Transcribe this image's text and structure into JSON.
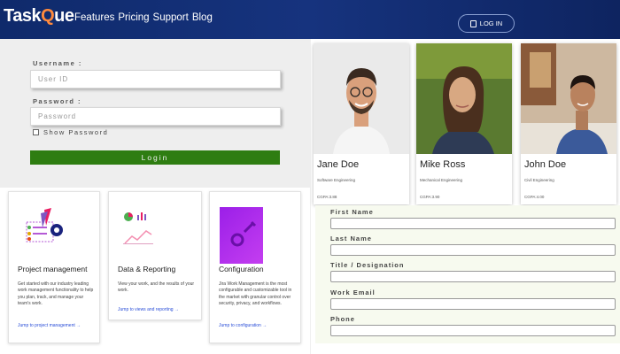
{
  "header": {
    "logo_left": "Task",
    "logo_q": "Q",
    "logo_right": "ue",
    "nav": [
      "Features",
      "Pricing",
      "Support",
      "Blog"
    ],
    "login_label": "LOG IN"
  },
  "login": {
    "username_label": "Username :",
    "username_placeholder": "User ID",
    "password_label": "Password :",
    "password_placeholder": "Password",
    "show_password": "Show Password",
    "button": "Login"
  },
  "features": [
    {
      "title": "Project management",
      "text": "Get started with our industry leading work management functionality to help you plan, track, and manage your team's work.",
      "link": "Jump to project management →"
    },
    {
      "title": "Data & Reporting",
      "text": "View your work, and the results of your work.",
      "link": "Jump to views and reporting →"
    },
    {
      "title": "Configuration",
      "text": "Jira Work Management is the most configurable and customizable tool in the market with granular control over security, privacy, and workflows.",
      "link": "Jump to configuration →"
    }
  ],
  "profiles": [
    {
      "name": "Jane Doe",
      "dept": "Software Engineering",
      "cgpa": "CGPA:3.88"
    },
    {
      "name": "Mike Ross",
      "dept": "Mechanical Engineering",
      "cgpa": "CGPA:3.90"
    },
    {
      "name": "John Doe",
      "dept": "Civil Engineering",
      "cgpa": "CGPA:4.00"
    }
  ],
  "form": {
    "first_name": "First Name",
    "last_name": "Last Name",
    "title": "Title / Designation",
    "work_email": "Work Email",
    "phone": "Phone"
  },
  "colors": {
    "header": "#16337e",
    "login_button": "#2e7d11",
    "accent": "#ff8a3d",
    "link": "#2b4fd8"
  }
}
